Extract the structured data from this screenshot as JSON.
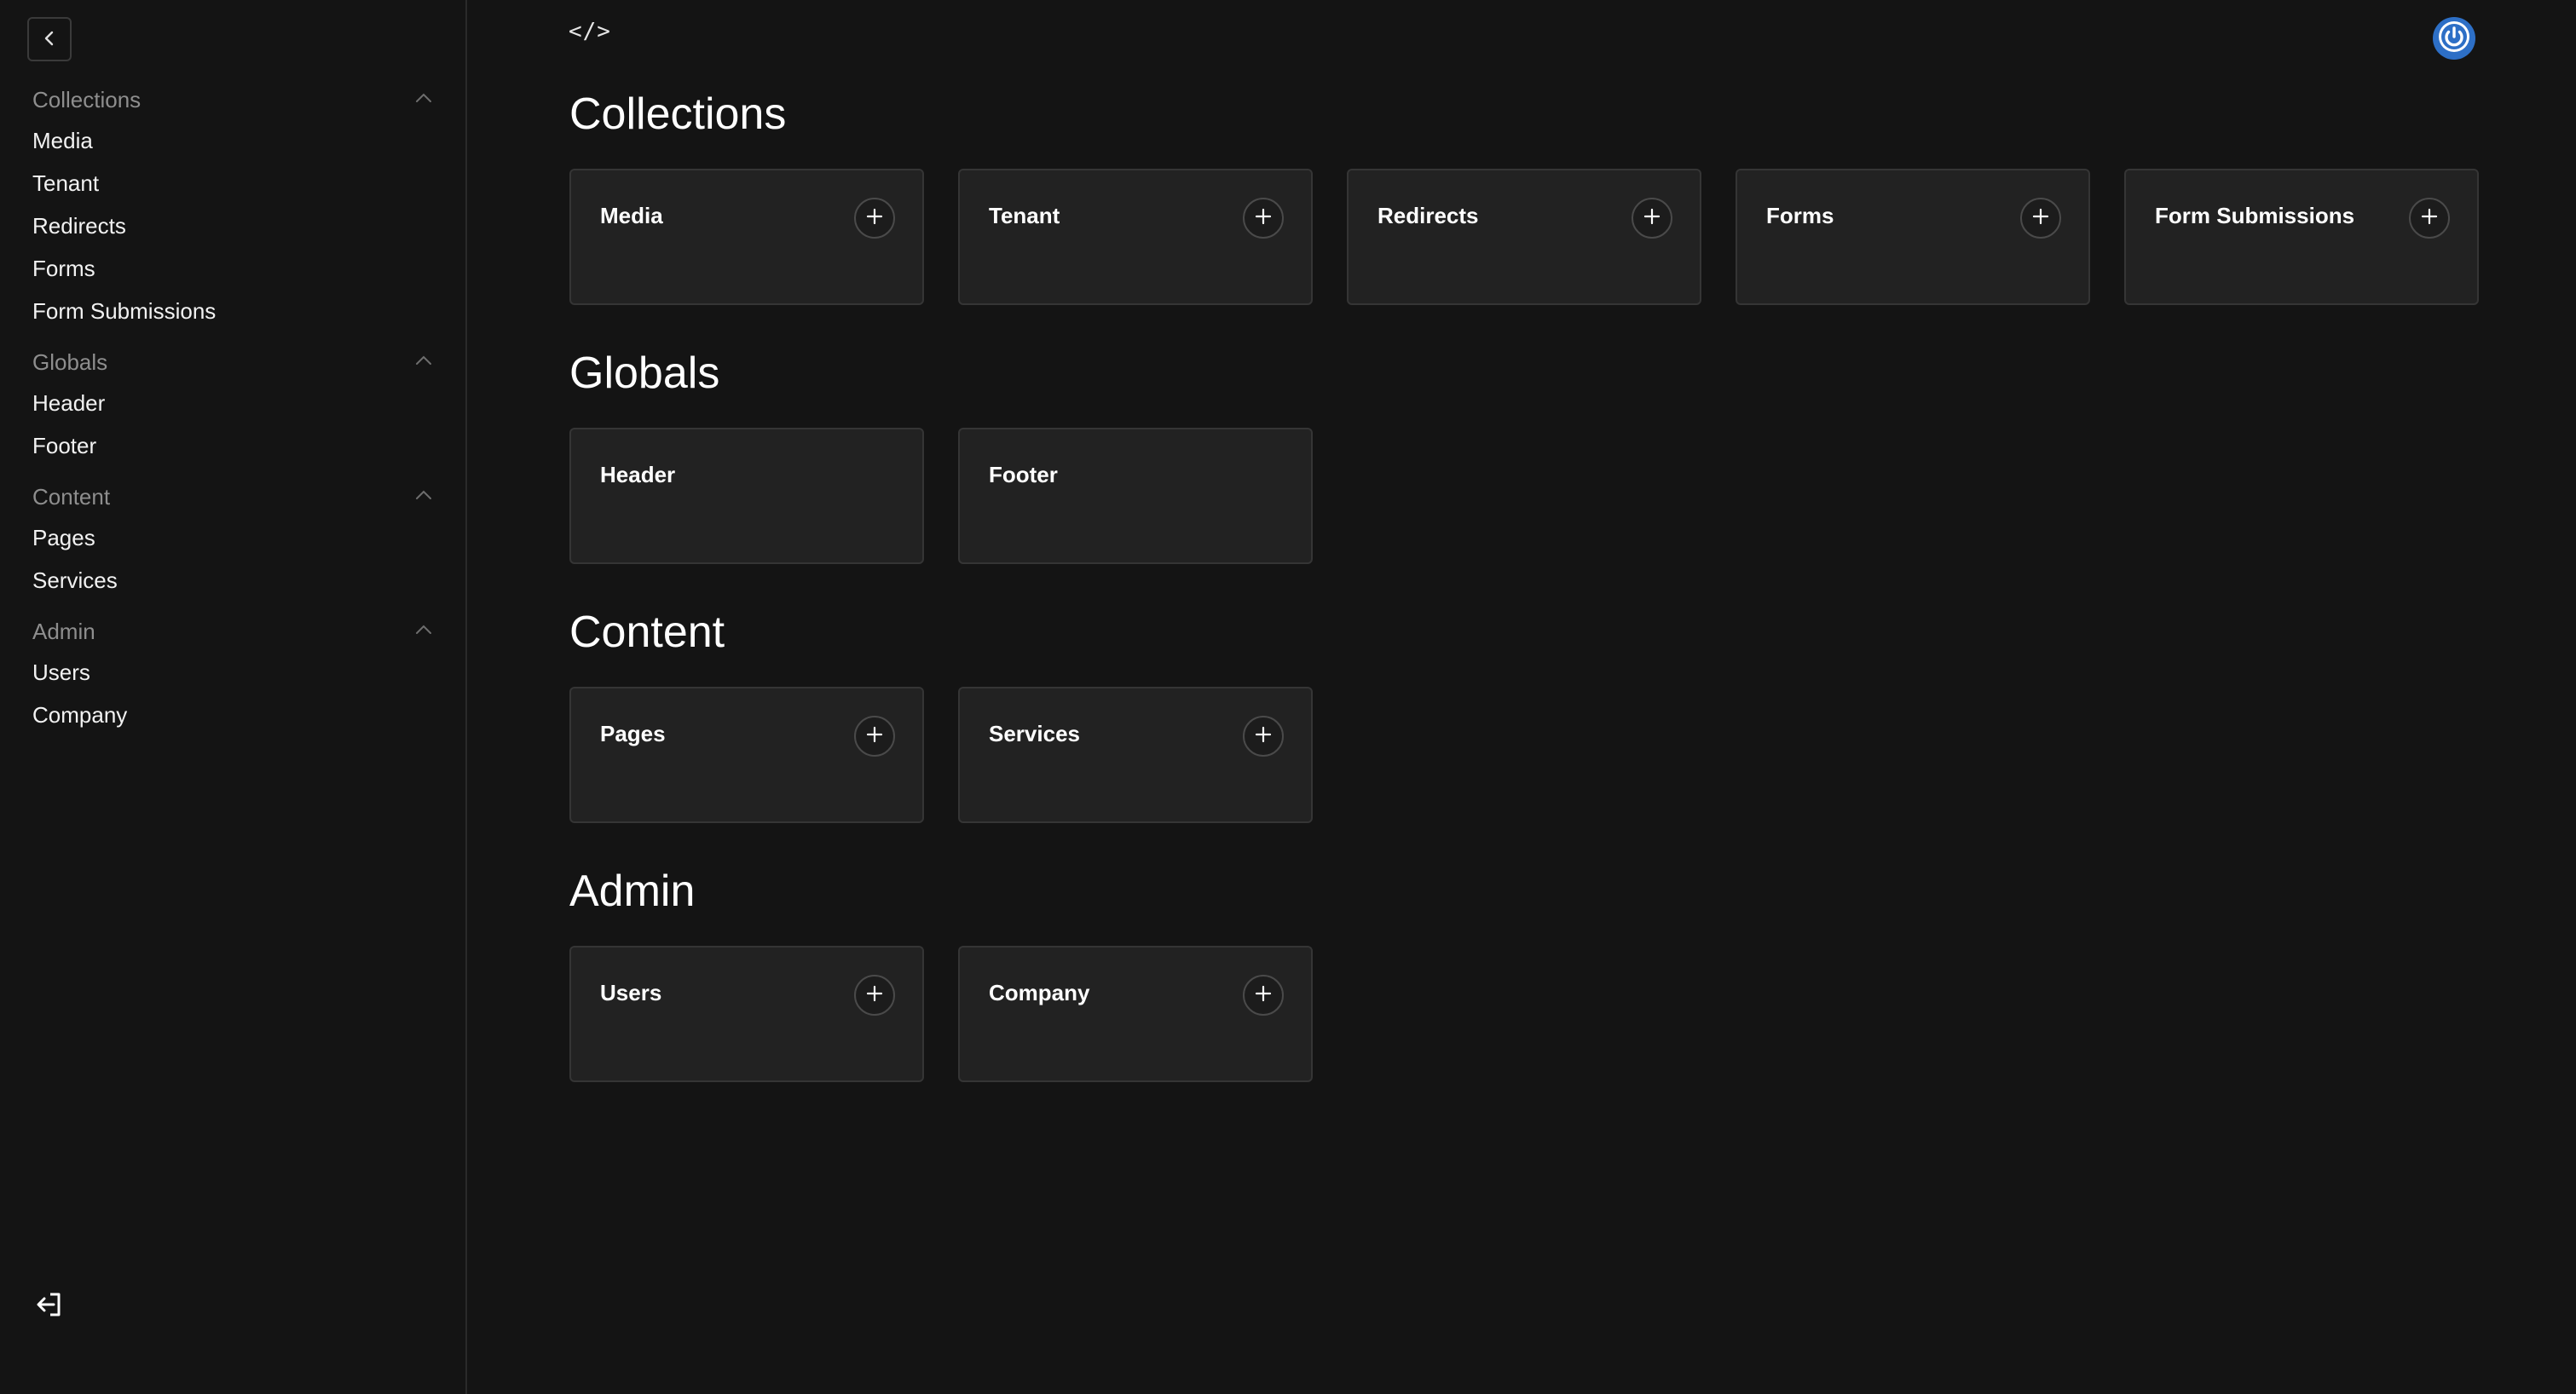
{
  "brand": {
    "logo_text": "</>",
    "account_color": "#2d6fc6"
  },
  "sidebar": {
    "groups": [
      {
        "label": "Collections",
        "items": [
          "Media",
          "Tenant",
          "Redirects",
          "Forms",
          "Form Submissions"
        ]
      },
      {
        "label": "Globals",
        "items": [
          "Header",
          "Footer"
        ]
      },
      {
        "label": "Content",
        "items": [
          "Pages",
          "Services"
        ]
      },
      {
        "label": "Admin",
        "items": [
          "Users",
          "Company"
        ]
      }
    ]
  },
  "main": {
    "sections": [
      {
        "title": "Collections",
        "cards": [
          {
            "label": "Media",
            "addable": true
          },
          {
            "label": "Tenant",
            "addable": true
          },
          {
            "label": "Redirects",
            "addable": true
          },
          {
            "label": "Forms",
            "addable": true
          },
          {
            "label": "Form Submissions",
            "addable": true
          }
        ]
      },
      {
        "title": "Globals",
        "cards": [
          {
            "label": "Header",
            "addable": false
          },
          {
            "label": "Footer",
            "addable": false
          }
        ]
      },
      {
        "title": "Content",
        "cards": [
          {
            "label": "Pages",
            "addable": true
          },
          {
            "label": "Services",
            "addable": true
          }
        ]
      },
      {
        "title": "Admin",
        "cards": [
          {
            "label": "Users",
            "addable": true
          },
          {
            "label": "Company",
            "addable": true
          }
        ]
      }
    ]
  },
  "icons": {
    "collapse": "chevron-left-icon",
    "group_toggle": "chevron-up-icon",
    "add": "plus-icon",
    "logout": "logout-icon",
    "account": "power-icon"
  }
}
